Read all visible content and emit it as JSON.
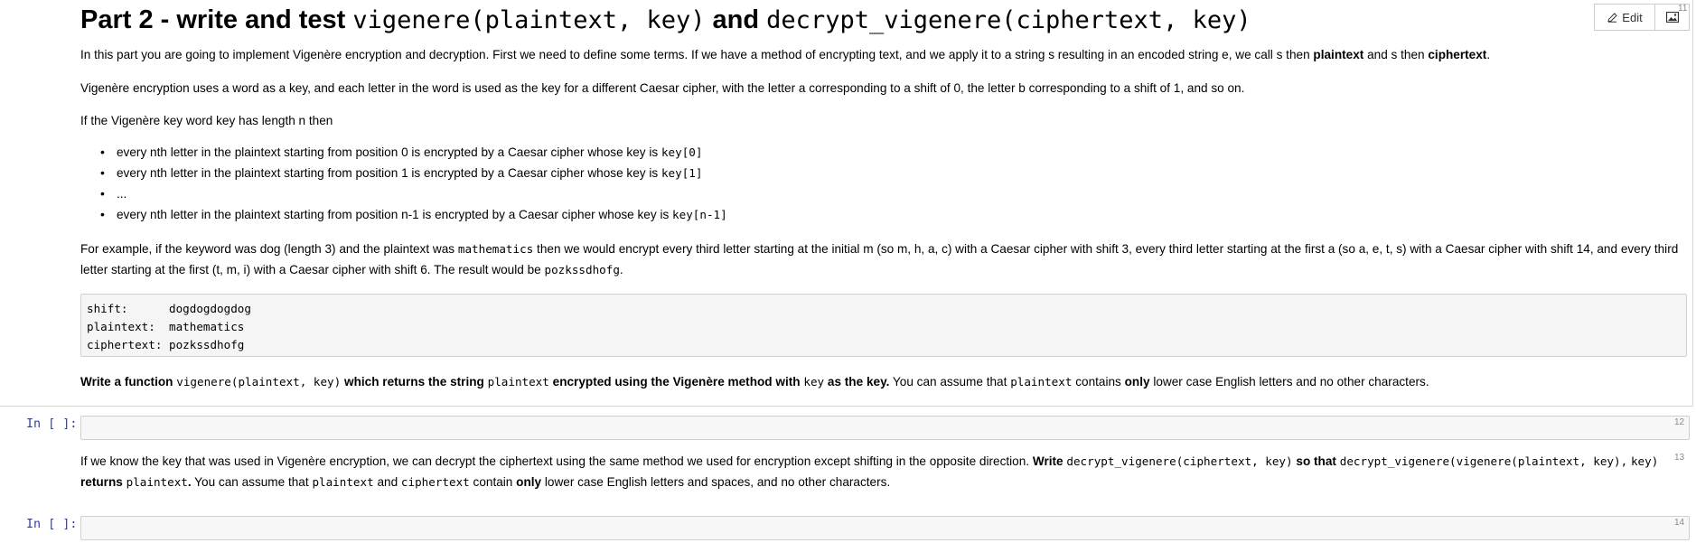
{
  "toolbar": {
    "edit_label": "Edit",
    "edit_icon": "pencil-icon",
    "image_icon": "image-icon"
  },
  "cells": {
    "md1": {
      "number": "11",
      "title_pre": "Part 2 - write and test ",
      "title_code1": "vigenere(plaintext, key)",
      "title_mid": " and ",
      "title_code2": "decrypt_vigenere(ciphertext, key)",
      "p1_a": "In this part you are going to implement Vigenère encryption and decryption. First we need to define some terms. If we have a method of encrypting text, and we apply it to a string s resulting in an encoded string e, we call s then ",
      "p1_b": "plaintext",
      "p1_c": " and s then ",
      "p1_d": "ciphertext",
      "p1_e": ".",
      "p2": "Vigenère encryption uses a word as a key, and each letter in the word is used as the key for a different Caesar cipher, with the letter a corresponding to a shift of 0, the letter b corresponding to a shift of 1, and so on.",
      "p3": "If the Vigenère key word key has length n then",
      "bullets": [
        {
          "text": "every nth letter in the plaintext starting from position 0 is encrypted by a Caesar cipher whose key is ",
          "code": "key[0]"
        },
        {
          "text": "every nth letter in the plaintext starting from position 1 is encrypted by a Caesar cipher whose key is ",
          "code": "key[1]"
        },
        {
          "text": "...",
          "code": ""
        },
        {
          "text": "every nth letter in the plaintext starting from position n-1 is encrypted by a Caesar cipher whose key is ",
          "code": "key[n-1]"
        }
      ],
      "p4_a": "For example, if the keyword was dog (length 3) and the plaintext was ",
      "p4_code1": "mathematics",
      "p4_b": " then we would encrypt every third letter starting at the initial m (so m, h, a, c) with a Caesar cipher with shift 3, every third letter starting at the first a (so a, e, t, s) with a Caesar cipher with shift 14, and every third letter starting at the first (t, m, i) with a Caesar cipher with shift 6. The result would be ",
      "p4_code2": "pozkssdhofg",
      "p4_c": ".",
      "code_block": "shift:      dogdogdogdog\nplaintext:  mathematics\nciphertext: pozkssdhofg",
      "p5_a": "Write a function ",
      "p5_code1": "vigenere(plaintext, key)",
      "p5_b": " which returns the string ",
      "p5_code2": "plaintext",
      "p5_c": " encrypted using the Vigenère method with ",
      "p5_code3": "key",
      "p5_d": " as the key.",
      "p5_e": " You can assume that ",
      "p5_code4": "plaintext",
      "p5_f": " contains ",
      "p5_g": "only",
      "p5_h": " lower case English letters and no other characters."
    },
    "code1": {
      "prompt": "In [ ]:",
      "number": "12"
    },
    "md2": {
      "number": "13",
      "a": "If we know the key that was used in Vigenère encryption, we can decrypt the ciphertext using the same method we used for encryption except shifting in the opposite direction. ",
      "b": "Write ",
      "code1": "decrypt_vigenere(ciphertext, key)",
      "c": " so that ",
      "code2": "decrypt_vigenere(vigenere(plaintext, key),",
      "code3": "key)",
      "d": " returns ",
      "code4": "plaintext",
      "e": ".",
      "f": " You can assume that ",
      "code5": "plaintext",
      "g": " and ",
      "code6": "ciphertext",
      "h": " contain ",
      "i": "only",
      "j": " lower case English letters and spaces, and no other characters."
    },
    "code2": {
      "prompt": "In [ ]:",
      "number": "14"
    }
  }
}
